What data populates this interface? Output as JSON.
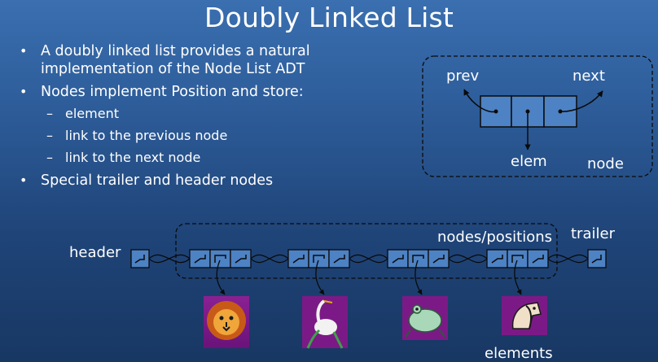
{
  "title": "Doubly Linked List",
  "bullets": [
    "A doubly linked list provides a natural implementation of the Node List ADT",
    "Nodes implement Position and store:",
    "Special trailer and header nodes"
  ],
  "sub_bullets": [
    "element",
    "link to the previous node",
    "link to the next node"
  ],
  "node_diagram": {
    "prev": "prev",
    "next": "next",
    "elem": "elem",
    "node": "node"
  },
  "list_diagram": {
    "header": "header",
    "trailer": "trailer",
    "nodes_positions": "nodes/positions",
    "elements": "elements"
  },
  "colors": {
    "cell_fill": "#4d82c4",
    "cell_stroke": "#0a0a0a",
    "element_bg": "#7b1a86"
  },
  "element_icons": [
    "lion-icon",
    "heron-icon",
    "frog-icon",
    "horse-icon"
  ]
}
